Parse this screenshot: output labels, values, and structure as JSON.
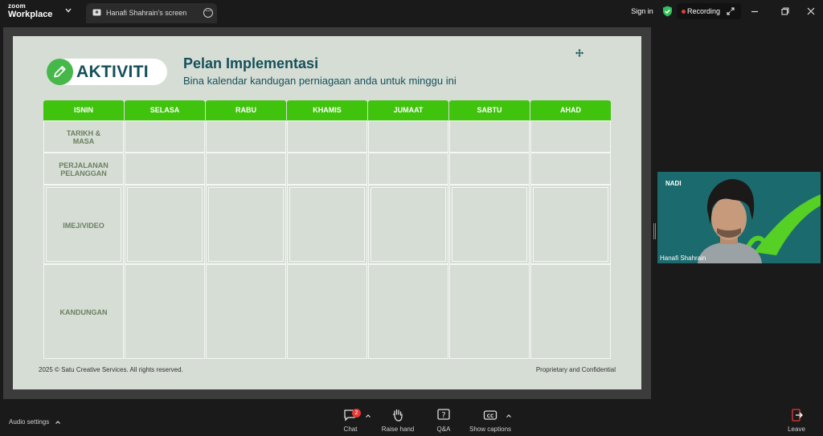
{
  "app": {
    "brand_top": "zoom",
    "brand_bottom": "Workplace"
  },
  "tab": {
    "title": "Hanafi Shahrain's screen"
  },
  "topbar": {
    "sign_in": "Sign in",
    "recording_label": "Recording"
  },
  "slide": {
    "badge": "AKTIVITI",
    "title": "Pelan Implementasi",
    "subtitle": "Bina kalendar kandugan perniagaan anda untuk minggu ini",
    "days": [
      "ISNIN",
      "SELASA",
      "RABU",
      "KHAMIS",
      "JUMAAT",
      "SABTU",
      "AHAD"
    ],
    "rows": [
      {
        "label": "TARIKH &\nMASA"
      },
      {
        "label": "PERJALANAN\nPELANGGAN"
      },
      {
        "label": "IMEJ/VIDEO"
      },
      {
        "label": "KANDUNGAN"
      }
    ],
    "footer_left": "2025 © Satu Creative Services. All rights reserved.",
    "footer_right": "Proprietary and Confidential"
  },
  "video": {
    "overlay_text": "NADI",
    "participant_name": "Hanafi Shahrain"
  },
  "bottombar": {
    "audio_settings": "Audio settings",
    "chat_label": "Chat",
    "chat_count": "2",
    "raise_hand_label": "Raise hand",
    "qa_label": "Q&A",
    "captions_label": "Show captions",
    "leave_label": "Leave"
  },
  "colors": {
    "accent_green": "#3fc30c",
    "teal_text": "#15505a",
    "slide_bg": "#d6ddd5",
    "recording_red": "#e0403a",
    "leave_red": "#e53935"
  }
}
